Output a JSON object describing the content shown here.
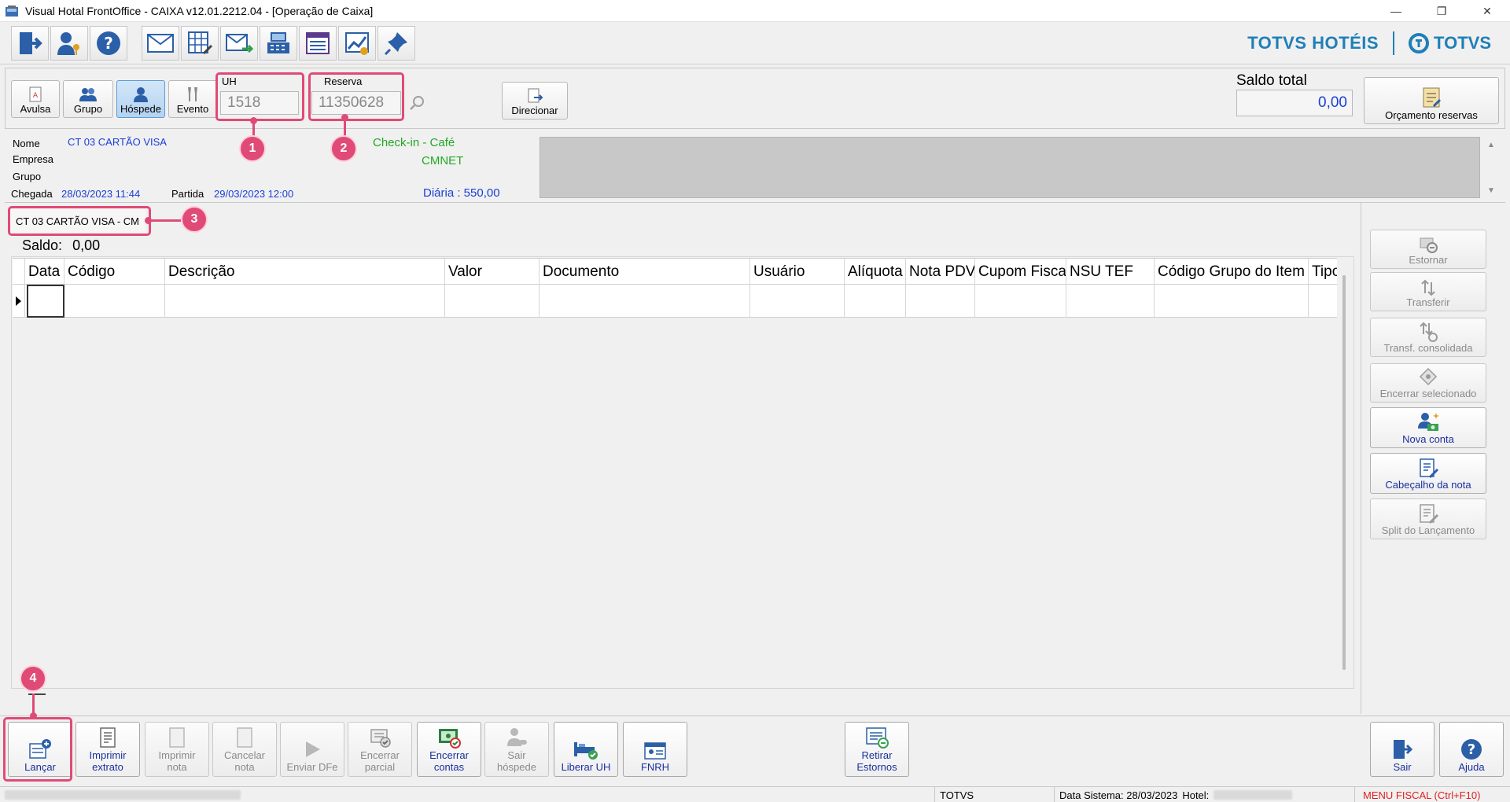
{
  "window": {
    "title": "Visual Hotal FrontOffice - CAIXA v12.01.2212.04 - [Operação de Caixa]",
    "minimize": "—",
    "restore": "❐",
    "close": "✕"
  },
  "brand": {
    "primary": "TOTVS HOTÉIS",
    "secondary": "TOTVS",
    "color": "#1f7fb8"
  },
  "modes": [
    {
      "label": "Avulsa"
    },
    {
      "label": "Grupo"
    },
    {
      "label": "Hóspede"
    },
    {
      "label": "Evento"
    }
  ],
  "uh": {
    "label": "UH",
    "value": "1518"
  },
  "reserva": {
    "label": "Reserva",
    "value": "11350628"
  },
  "direcionar_label": "Direcionar",
  "saldo_total": {
    "label": "Saldo total",
    "value": "0,00"
  },
  "orcamento_label": "Orçamento reservas",
  "guest": {
    "nome_label": "Nome",
    "nome_value": "CT 03 CARTÃO VISA",
    "empresa_label": "Empresa",
    "grupo_label": "Grupo",
    "chegada_label": "Chegada",
    "chegada_value": "28/03/2023 11:44",
    "partida_label": "Partida",
    "partida_value": "29/03/2023 12:00",
    "checkin_text": "Check-in -  Café",
    "cmnet_text": "CMNET",
    "diaria_text": "Diária : 550,00"
  },
  "account": {
    "tab_label": "CT 03 CARTÃO VISA - CM",
    "saldo_label": "Saldo:",
    "saldo_value": "0,00"
  },
  "grid": {
    "columns": [
      "Data",
      "Código",
      "Descrição",
      "Valor",
      "Documento",
      "Usuário",
      "Alíquota",
      "Nota PDV",
      "Cupom Fiscal",
      "NSU TEF",
      "Código Grupo do Item",
      "Tipo"
    ]
  },
  "side_buttons": [
    {
      "label": "Estornar",
      "enabled": false
    },
    {
      "label": "Transferir",
      "enabled": false
    },
    {
      "label": "Transf. consolidada",
      "enabled": false
    },
    {
      "label": "Encerrar selecionado",
      "enabled": false
    },
    {
      "label": "Nova conta",
      "enabled": true
    },
    {
      "label": "Cabeçalho da nota",
      "enabled": true
    },
    {
      "label": "Split do Lançamento",
      "enabled": false
    }
  ],
  "bottom_buttons": [
    {
      "label": "Lançar",
      "enabled": true
    },
    {
      "label": "Imprimir\nextrato",
      "enabled": true
    },
    {
      "label": "Imprimir\nnota",
      "enabled": false
    },
    {
      "label": "Cancelar\nnota",
      "enabled": false
    },
    {
      "label": "Enviar DFe",
      "enabled": false
    },
    {
      "label": "Encerrar\nparcial",
      "enabled": false
    },
    {
      "label": "Encerrar\ncontas",
      "enabled": true
    },
    {
      "label": "Sair\nhóspede",
      "enabled": false
    },
    {
      "label": "Liberar UH",
      "enabled": true
    },
    {
      "label": "FNRH",
      "enabled": true
    },
    {
      "label": "Retirar\nEstornos",
      "enabled": true
    },
    {
      "label": "Sair",
      "enabled": true
    },
    {
      "label": "Ajuda",
      "enabled": true
    }
  ],
  "status": {
    "company": "TOTVS",
    "data_sistema": "Data Sistema: 28/03/2023",
    "hotel_label": "Hotel:",
    "menu_fiscal": "MENU FISCAL (Ctrl+F10)"
  },
  "callouts": [
    "1",
    "2",
    "3",
    "4"
  ],
  "colors": {
    "callout": "#e04a77",
    "link_blue": "#1a3fd6",
    "green": "#22a822",
    "enabled_btn": "#1a2f9e",
    "menu_fiscal": "#e02020"
  }
}
